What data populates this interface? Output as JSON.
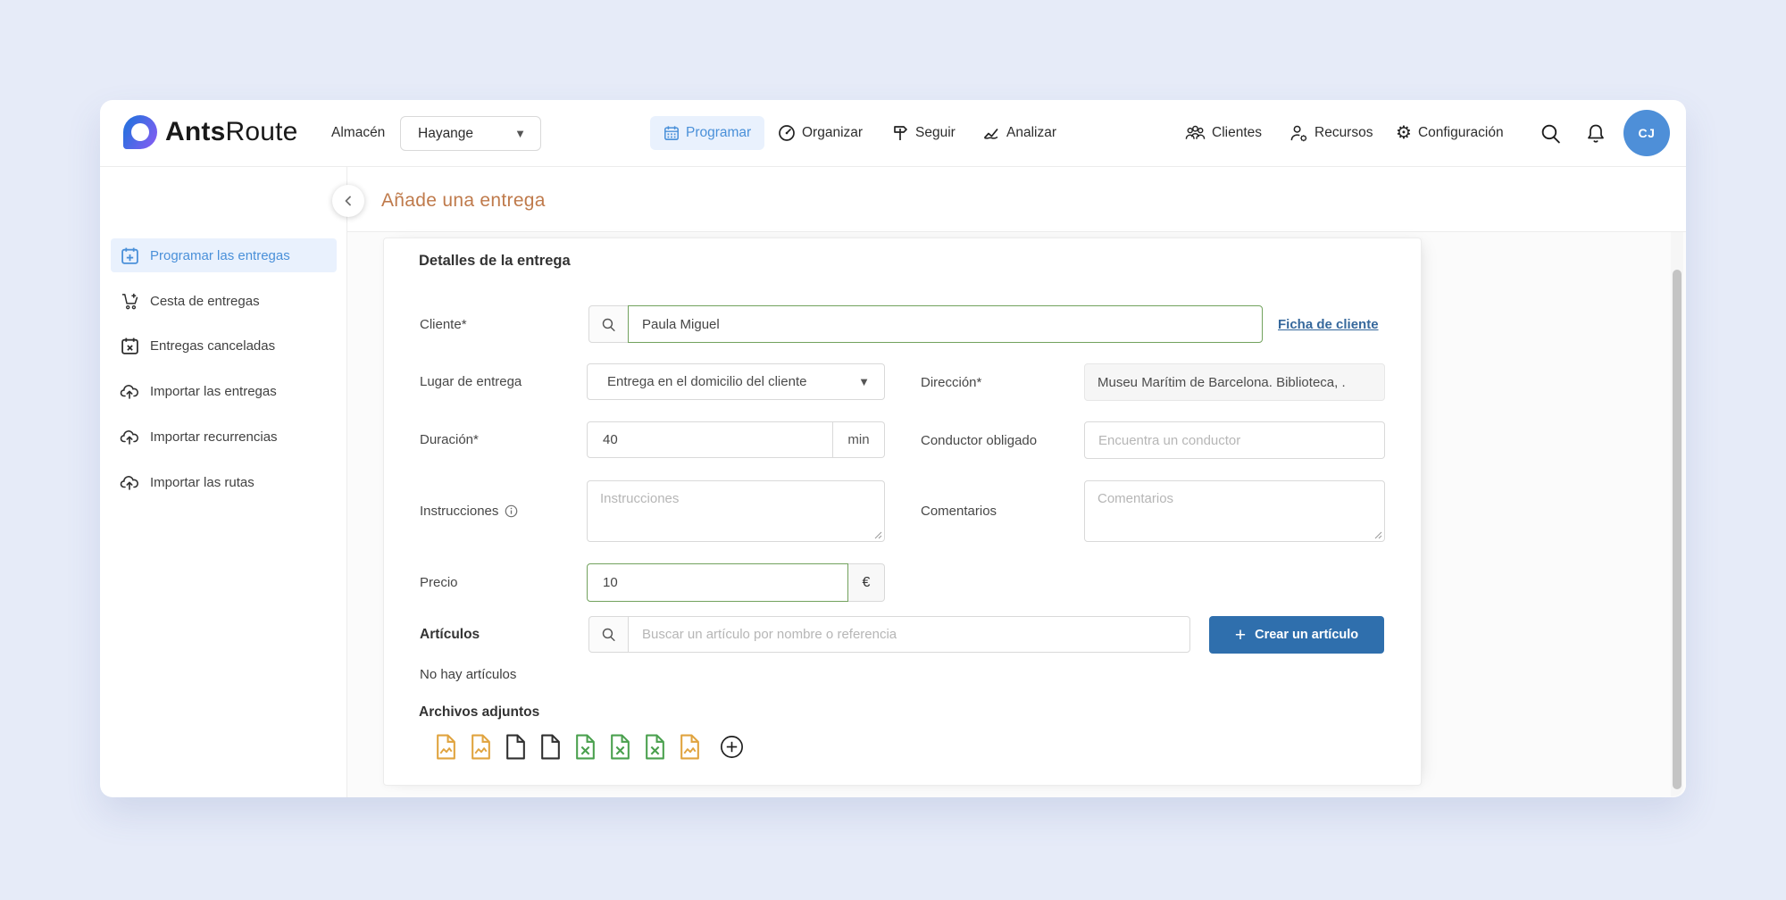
{
  "brand": {
    "bold": "Ants",
    "light": "Route"
  },
  "topbar": {
    "warehouse_label": "Almacén",
    "warehouse_value": "Hayange",
    "tabs": [
      {
        "label": "Programar",
        "active": true
      },
      {
        "label": "Organizar",
        "active": false
      },
      {
        "label": "Seguir",
        "active": false
      },
      {
        "label": "Analizar",
        "active": false
      }
    ],
    "right": [
      {
        "label": "Clientes"
      },
      {
        "label": "Recursos"
      },
      {
        "label": "Configuración"
      }
    ],
    "avatar_initials": "CJ"
  },
  "sidebar": {
    "items": [
      {
        "label": "Programar las entregas",
        "active": true
      },
      {
        "label": "Cesta de entregas",
        "active": false
      },
      {
        "label": "Entregas canceladas",
        "active": false
      },
      {
        "label": "Importar las entregas",
        "active": false
      },
      {
        "label": "Importar recurrencias",
        "active": false
      },
      {
        "label": "Importar las rutas",
        "active": false
      }
    ]
  },
  "header": {
    "title": "Añade una entrega"
  },
  "form": {
    "section_title": "Detalles de la entrega",
    "cliente": {
      "label": "Cliente*",
      "value": "Paula Miguel",
      "link": "Ficha de cliente"
    },
    "lugar": {
      "label": "Lugar de entrega",
      "value": "Entrega en el domicilio del cliente"
    },
    "direccion": {
      "label": "Dirección*",
      "value": "Museu Marítim de Barcelona. Biblioteca, ."
    },
    "duracion": {
      "label": "Duración*",
      "value": "40",
      "suffix": "min"
    },
    "conductor": {
      "label": "Conductor obligado",
      "placeholder": "Encuentra un conductor"
    },
    "instrucciones": {
      "label": "Instrucciones",
      "placeholder": "Instrucciones"
    },
    "comentarios": {
      "label": "Comentarios",
      "placeholder": "Comentarios"
    },
    "precio": {
      "label": "Precio",
      "value": "10",
      "suffix": "€"
    },
    "articulos": {
      "label": "Artículos",
      "placeholder": "Buscar un artículo por nombre o referencia",
      "button_plus": "+",
      "button_label": "Crear un artículo",
      "empty": "No hay artículos"
    },
    "adjuntos": {
      "label": "Archivos adjuntos",
      "files": [
        "image",
        "image",
        "document",
        "document",
        "excel",
        "excel",
        "excel",
        "image"
      ],
      "add_button": "add-attachment"
    }
  },
  "colors": {
    "background": "#e6ebf8",
    "accent_blue": "#4a90d9",
    "active_pill": "#e9f1fd",
    "title_orange": "#bf7a4b",
    "link_blue": "#36689c",
    "green_border": "#72a25d",
    "button_blue": "#2f6fad",
    "file_orange": "#e0a33e",
    "file_green": "#4aa04e",
    "avatar_blue": "#4e8fd8"
  }
}
